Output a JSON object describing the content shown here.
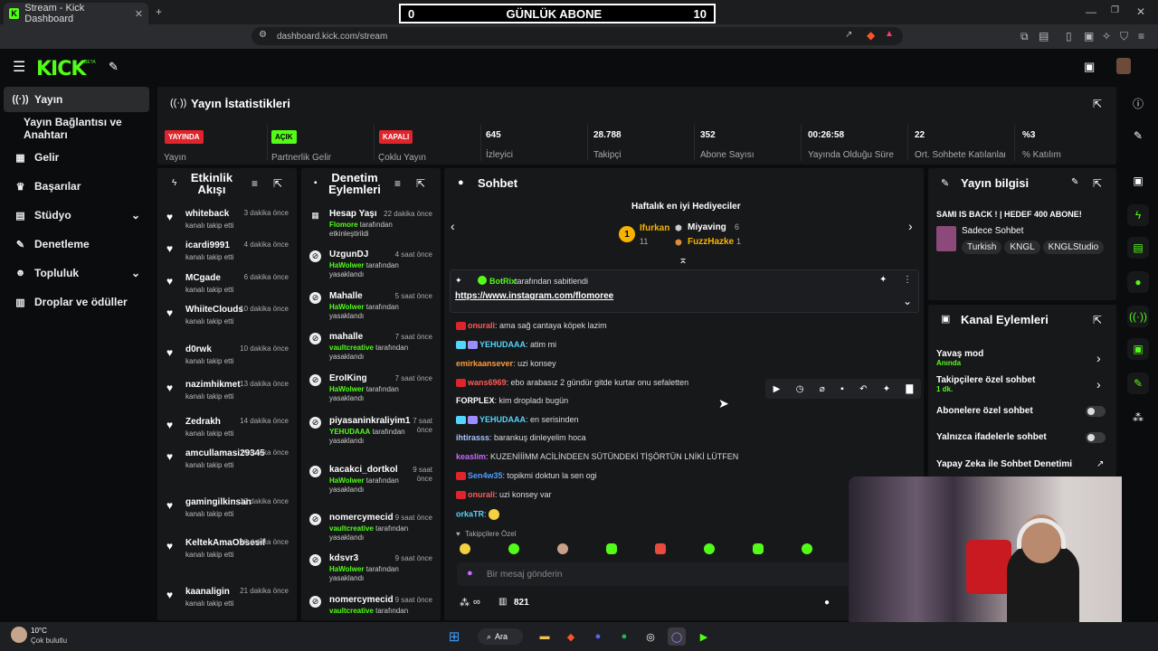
{
  "browser": {
    "tab_title": "Stream - Kick Dashboard",
    "url": "dashboard.kick.com/stream"
  },
  "overlay": {
    "left": "0",
    "title": "GÜNLÜK ABONE",
    "right": "10"
  },
  "brand": {
    "logo": "KICK",
    "beta": "BETA",
    "accent": "#53fc18"
  },
  "sidebar": {
    "items": [
      {
        "label": "Yayın",
        "icon": "broadcast-icon"
      },
      {
        "label": "Yayın Bağlantısı ve Anahtarı",
        "icon": ""
      },
      {
        "label": "Gelir",
        "icon": "revenue-icon"
      },
      {
        "label": "Başarılar",
        "icon": "trophy-icon"
      },
      {
        "label": "Stüdyo",
        "icon": "studio-icon"
      },
      {
        "label": "Denetleme",
        "icon": "wrench-icon"
      },
      {
        "label": "Topluluk",
        "icon": "community-icon"
      },
      {
        "label": "Droplar ve ödüller",
        "icon": "drops-icon"
      }
    ]
  },
  "stats": {
    "title": "Yayın İstatistikleri",
    "items": [
      {
        "badge": "YAYINDA",
        "label": "Yayın"
      },
      {
        "badge": "AÇIK",
        "label": "Partnerlik Gelir"
      },
      {
        "badge": "KAPALI",
        "label": "Çoklu Yayın"
      },
      {
        "value": "645",
        "label": "İzleyici"
      },
      {
        "value": "28.788",
        "label": "Takipçi"
      },
      {
        "value": "352",
        "label": "Abone Sayısı"
      },
      {
        "value": "00:26:58",
        "label": "Yayında Olduğu Süre"
      },
      {
        "value": "22",
        "label": "Ort. Sohbete Katılanlar"
      },
      {
        "value": "%3",
        "label": "% Katılım"
      }
    ]
  },
  "activity": {
    "title": "Etkinlik Akışı",
    "rows": [
      {
        "name": "whiteback",
        "time": "3 dakika önce",
        "sub": "kanalı takip etti"
      },
      {
        "name": "icardi9991",
        "time": "4 dakika önce",
        "sub": "kanalı takip etti"
      },
      {
        "name": "MCgade",
        "time": "6 dakika önce",
        "sub": "kanalı takip etti"
      },
      {
        "name": "WhiiteClouds",
        "time": "10 dakika önce",
        "sub": "kanalı takip etti"
      },
      {
        "name": "d0rwk",
        "time": "10 dakika önce",
        "sub": "kanalı takip etti"
      },
      {
        "name": "nazimhikmet",
        "time": "13 dakika önce",
        "sub": "kanalı takip etti"
      },
      {
        "name": "Zedrakh",
        "time": "14 dakika önce",
        "sub": "kanalı takip etti"
      },
      {
        "name": "amcullamasi29345",
        "time": "16 dakika önce",
        "sub": "kanalı takip etti"
      },
      {
        "name": "gamingilkinsan",
        "time": "17 dakika önce",
        "sub": "kanalı takip etti"
      },
      {
        "name": "KeltekAmaObsesif",
        "time": "18 dakika önce",
        "sub": "kanalı takip etti"
      },
      {
        "name": "kaanaligin",
        "time": "21 dakika önce",
        "sub": "kanalı takip etti"
      }
    ]
  },
  "moderation": {
    "title": "Denetim Eylemleri",
    "rows": [
      {
        "name": "Hesap Yaşı",
        "time": "22 dakika önce",
        "actor": "Flomore",
        "action": "tarafından etkinleştirildi"
      },
      {
        "name": "UzgunDJ",
        "time": "4 saat önce",
        "actor": "HaWolwer",
        "action": "tarafından yasaklandı"
      },
      {
        "name": "Mahalle",
        "time": "5 saat önce",
        "actor": "HaWolwer",
        "action": "tarafından yasaklandı"
      },
      {
        "name": "mahalle",
        "time": "7 saat önce",
        "actor": "vaultcreative",
        "action": "tarafından yasaklandı"
      },
      {
        "name": "EroIKing",
        "time": "7 saat önce",
        "actor": "HaWolwer",
        "action": "tarafından yasaklandı"
      },
      {
        "name": "piyasaninkraliyim1",
        "time": "7 saat önce",
        "actor": "YEHUDAAA",
        "action": "tarafından yasaklandı"
      },
      {
        "name": "kacakci_dortkol",
        "time": "9 saat önce",
        "actor": "HaWolwer",
        "action": "tarafından yasaklandı"
      },
      {
        "name": "nomercymecid",
        "time": "9 saat önce",
        "actor": "vaultcreative",
        "action": "tarafından yasaklandı"
      },
      {
        "name": "kdsvr3",
        "time": "9 saat önce",
        "actor": "HaWolwer",
        "action": "tarafından yasaklandı"
      },
      {
        "name": "nomercymecid",
        "time": "9 saat önce",
        "actor": "vaultcreative",
        "action": "tarafından"
      }
    ]
  },
  "chat": {
    "title": "Sohbet",
    "gifters_title": "Haftalık en iyi Hediyeciler",
    "gifters": [
      {
        "rank": "1",
        "name": "Ifurkan",
        "count": "11"
      },
      {
        "rank": "2",
        "name": "Miyaving",
        "count": "6"
      },
      {
        "rank": "3",
        "name": "FuzzHazke",
        "count": "1"
      }
    ],
    "pinned_by": "BotRix",
    "pinned_suffix": "tarafından sabitlendi",
    "pinned_link": "https://www.instagram.com/flomoree",
    "messages": [
      {
        "user": "onurali",
        "color": "#ff5a5a",
        "text": "ama sağ cantaya köpek lazim"
      },
      {
        "user": "YEHUDAAA",
        "color": "#53d5fd",
        "text": "atim mi"
      },
      {
        "user": "emirkaansever",
        "color": "#ff9a3c",
        "text": "uzi konsey"
      },
      {
        "user": "wans6969",
        "color": "#ff5a5a",
        "text": "ebo arabasız 2 gündür gitde kurtar onu sefaletten"
      },
      {
        "user": "FORPLEX",
        "color": "#ffffff",
        "text": "kim dropladı bugün"
      },
      {
        "user": "YEHUDAAA",
        "color": "#53d5fd",
        "text": "en serisinden"
      },
      {
        "user": "ihtirasss",
        "color": "#a9c7ff",
        "text": "barankuş dinleyelim hoca"
      },
      {
        "user": "keaslim",
        "color": "#c86bff",
        "text": "KUZENİİİMM ACİLİNDEEN SÜTÜNDEKİ TİŞÖRTÜN LNİKİ LÜTFEN"
      },
      {
        "user": "Sen4w35",
        "color": "#4f9dff",
        "text": "topikmi doktun la sen ogi"
      },
      {
        "user": "onurali",
        "color": "#ff5a5a",
        "text": "uzi konsey var"
      },
      {
        "user": "orkaTR",
        "color": "#53d5fd",
        "text": ""
      }
    ],
    "followers_only": "Takipçilere Özel",
    "input_placeholder": "Bir mesaj gönderin",
    "viewer_count": "821"
  },
  "stream_info": {
    "title": "Yayın bilgisi",
    "stream_title": "SAMI IS BACK ! | HEDEF 400 ABONE!",
    "category": "Sadece Sohbet",
    "tags": [
      "Turkish",
      "KNGL",
      "KNGLStudio"
    ]
  },
  "channel_actions": {
    "title": "Kanal Eylemleri",
    "slow_mode": "Yavaş mod",
    "slow_mode_sub": "Anında",
    "followers_chat": "Takipçilere özel sohbet",
    "followers_chat_sub": "1 dk.",
    "subs_chat": "Abonelere özel sohbet",
    "emotes_chat": "Yalnızca ifadelerle sohbet",
    "ai_mod": "Yapay Zeka ile Sohbet Denetimi"
  },
  "taskbar": {
    "weather_temp": "10°C",
    "weather_text": "Çok bulutlu",
    "search": "Ara"
  }
}
